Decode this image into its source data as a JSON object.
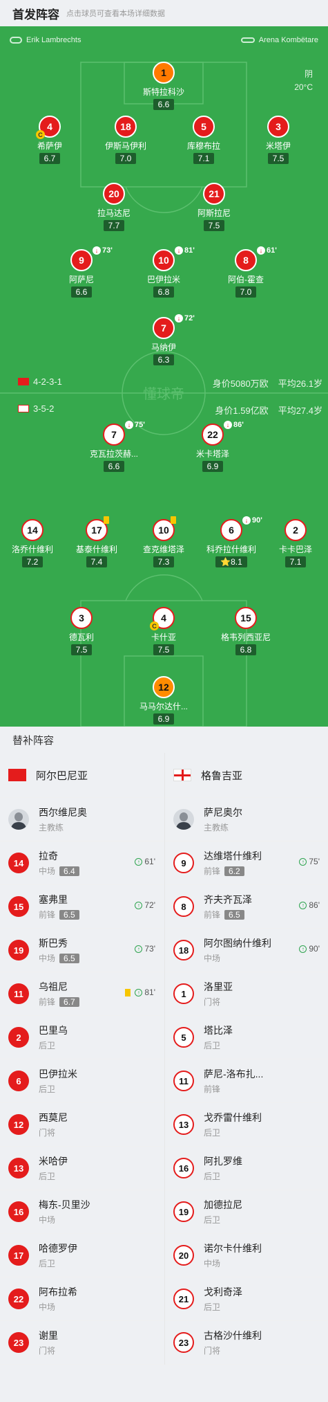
{
  "header": {
    "title": "首发阵容",
    "subtitle": "点击球员可查看本场详细数据"
  },
  "pitch": {
    "referee": "Erik Lambrechts",
    "stadium": "Arena Kombëtare",
    "weather": "阴",
    "temperature": "20°C",
    "watermark": "懂球帝",
    "home": {
      "formation": "4-2-3-1",
      "value": "身价5080万欧",
      "age": "平均26.1岁"
    },
    "away": {
      "formation": "3-5-2",
      "value": "身价1.59亿欧",
      "age": "平均27.4岁"
    }
  },
  "home_players": [
    {
      "num": "1",
      "name": "斯特拉科沙",
      "rating": "6.6",
      "kind": "gk"
    },
    {
      "num": "4",
      "name": "希萨伊",
      "rating": "6.7",
      "kind": "red",
      "captain": "C"
    },
    {
      "num": "18",
      "name": "伊斯马伊利",
      "rating": "7.0",
      "kind": "red"
    },
    {
      "num": "5",
      "name": "库穆布拉",
      "rating": "7.1",
      "kind": "red"
    },
    {
      "num": "3",
      "name": "米塔伊",
      "rating": "7.5",
      "kind": "red"
    },
    {
      "num": "20",
      "name": "拉马达尼",
      "rating": "7.7",
      "kind": "red"
    },
    {
      "num": "21",
      "name": "阿斯拉尼",
      "rating": "7.5",
      "kind": "red"
    },
    {
      "num": "9",
      "name": "阿萨尼",
      "rating": "6.6",
      "kind": "red",
      "sub": "73'"
    },
    {
      "num": "10",
      "name": "巴伊拉米",
      "rating": "6.8",
      "kind": "red",
      "sub": "81'"
    },
    {
      "num": "8",
      "name": "阿伯-霍查",
      "rating": "7.0",
      "kind": "red",
      "sub": "61'"
    },
    {
      "num": "7",
      "name": "马纳伊",
      "rating": "6.3",
      "kind": "red",
      "sub": "72'"
    }
  ],
  "away_players": [
    {
      "num": "7",
      "name": "克瓦拉茨赫...",
      "rating": "6.6",
      "kind": "geo",
      "sub": "75'"
    },
    {
      "num": "22",
      "name": "米卡塔泽",
      "rating": "6.9",
      "kind": "geo",
      "sub": "86'"
    },
    {
      "num": "14",
      "name": "洛乔什维利",
      "rating": "7.2",
      "kind": "geo"
    },
    {
      "num": "17",
      "name": "基泰什维利",
      "rating": "7.4",
      "kind": "geo",
      "card": "yellow"
    },
    {
      "num": "10",
      "name": "查克维塔泽",
      "rating": "7.3",
      "kind": "geo",
      "card": "yellow"
    },
    {
      "num": "6",
      "name": "科乔拉什维利",
      "rating": "8.1",
      "kind": "geo",
      "sub": "90'",
      "star": "⭐"
    },
    {
      "num": "2",
      "name": "卡卡巴泽",
      "rating": "7.1",
      "kind": "geo"
    },
    {
      "num": "3",
      "name": "德瓦利",
      "rating": "7.5",
      "kind": "geo"
    },
    {
      "num": "4",
      "name": "卡什亚",
      "rating": "7.5",
      "kind": "geo",
      "captain": "C"
    },
    {
      "num": "15",
      "name": "格韦列西亚尼",
      "rating": "6.8",
      "kind": "geo"
    },
    {
      "num": "12",
      "name": "马马尔达什...",
      "rating": "6.9",
      "kind": "geogk"
    }
  ],
  "subs_title": "替补阵容",
  "bench": {
    "home_team": "阿尔巴尼亚",
    "away_team": "格鲁吉亚",
    "home_coach": {
      "name": "西尔维尼奥",
      "role": "主教练"
    },
    "away_coach": {
      "name": "萨尼奥尔",
      "role": "主教练"
    },
    "home": [
      {
        "num": "14",
        "name": "拉奇",
        "pos": "中场",
        "rating": "6.4",
        "sub": "61'"
      },
      {
        "num": "15",
        "name": "塞弗里",
        "pos": "前锋",
        "rating": "6.5",
        "sub": "72'"
      },
      {
        "num": "19",
        "name": "斯巴秀",
        "pos": "中场",
        "rating": "6.5",
        "sub": "73'"
      },
      {
        "num": "11",
        "name": "乌祖尼",
        "pos": "前锋",
        "rating": "6.7",
        "sub": "81'",
        "card": "yellow"
      },
      {
        "num": "2",
        "name": "巴里乌",
        "pos": "后卫"
      },
      {
        "num": "6",
        "name": "巴伊拉米",
        "pos": "后卫"
      },
      {
        "num": "12",
        "name": "西莫尼",
        "pos": "门将"
      },
      {
        "num": "13",
        "name": "米哈伊",
        "pos": "后卫"
      },
      {
        "num": "16",
        "name": "梅东-贝里沙",
        "pos": "中场"
      },
      {
        "num": "17",
        "name": "哈德罗伊",
        "pos": "后卫"
      },
      {
        "num": "22",
        "name": "阿布拉希",
        "pos": "中场"
      },
      {
        "num": "23",
        "name": "谢里",
        "pos": "门将"
      }
    ],
    "away": [
      {
        "num": "9",
        "name": "达维塔什维利",
        "pos": "前锋",
        "rating": "6.2",
        "sub": "75'"
      },
      {
        "num": "8",
        "name": "齐夫齐瓦泽",
        "pos": "前锋",
        "rating": "6.5",
        "sub": "86'"
      },
      {
        "num": "18",
        "name": "阿尔图纳什维利",
        "pos": "中场",
        "sub": "90'"
      },
      {
        "num": "1",
        "name": "洛里亚",
        "pos": "门将"
      },
      {
        "num": "5",
        "name": "塔比泽",
        "pos": "后卫"
      },
      {
        "num": "11",
        "name": "萨尼-洛布扎...",
        "pos": "前锋"
      },
      {
        "num": "13",
        "name": "戈乔雷什维利",
        "pos": "后卫"
      },
      {
        "num": "16",
        "name": "阿扎罗维",
        "pos": "后卫"
      },
      {
        "num": "19",
        "name": "加德拉尼",
        "pos": "后卫"
      },
      {
        "num": "20",
        "name": "诺尔卡什维利",
        "pos": "中场"
      },
      {
        "num": "21",
        "name": "戈利奇泽",
        "pos": "后卫"
      },
      {
        "num": "23",
        "name": "古格沙什维利",
        "pos": "门将"
      }
    ]
  }
}
